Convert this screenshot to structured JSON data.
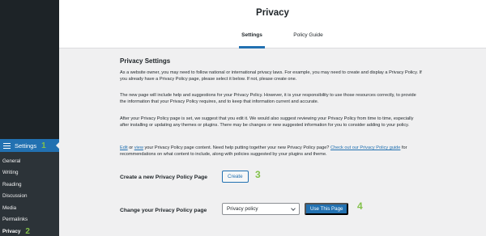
{
  "sidebar": {
    "settings_label": "Settings",
    "settings_step": "1",
    "items": [
      {
        "label": "General"
      },
      {
        "label": "Writing"
      },
      {
        "label": "Reading"
      },
      {
        "label": "Discussion"
      },
      {
        "label": "Media"
      },
      {
        "label": "Permalinks"
      },
      {
        "label": "Privacy",
        "step": "2"
      }
    ]
  },
  "header": {
    "title": "Privacy",
    "tabs": [
      {
        "label": "Settings",
        "active": true
      },
      {
        "label": "Policy Guide",
        "active": false
      }
    ]
  },
  "main": {
    "heading": "Privacy Settings",
    "p1": "As a website owner, you may need to follow national or international privacy laws. For example, you may need to create and display a Privacy Policy. If you already have a Privacy Policy page, please select it below. If not, please create one.",
    "p2": "The new page will include help and suggestions for your Privacy Policy. However, it is your responsibility to use those resources correctly, to provide the information that your Privacy Policy requires, and to keep that information current and accurate.",
    "p3": "After your Privacy Policy page is set, we suggest that you edit it. We would also suggest reviewing your Privacy Policy from time to time, especially after installing or updating any themes or plugins. There may be changes or new suggested information for you to consider adding to your policy.",
    "p4": {
      "edit_link": "Edit",
      "or": " or ",
      "view_link": "view",
      "middle": " your Privacy Policy page content. Need help putting together your new Privacy Policy page? ",
      "guide_link": "Check out our Privacy Policy guide",
      "end": " for recommendations on what content to include, along with policies suggested by your plugins and theme."
    },
    "create_label": "Create a new Privacy Policy Page",
    "create_button": "Create",
    "create_step": "3",
    "change_label": "Change your Privacy Policy page",
    "select_value": "Privacy policy",
    "use_button": "Use This Page",
    "use_step": "4"
  },
  "colors": {
    "accent": "#2271b1",
    "sidebar_bg": "#1d2327",
    "step_marker": "#83c14a"
  }
}
